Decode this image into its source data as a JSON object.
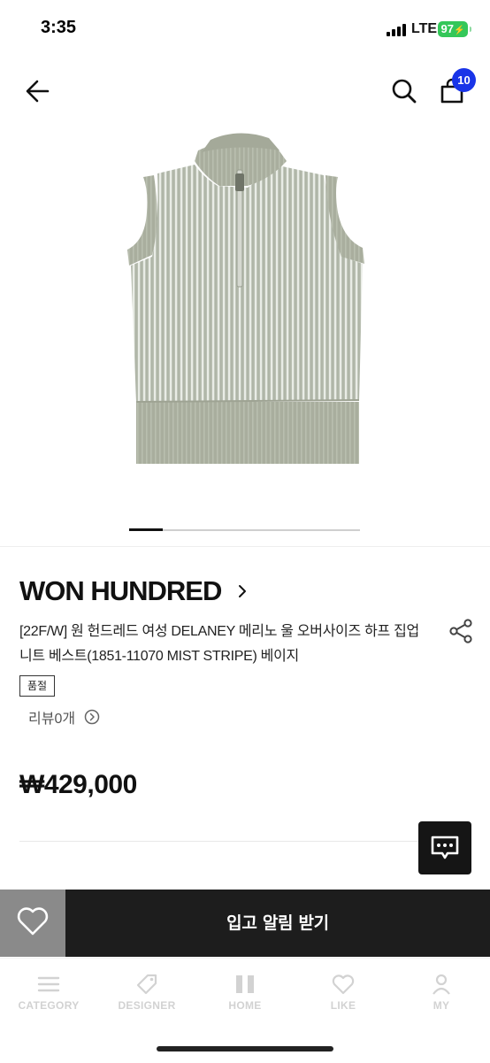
{
  "status_bar": {
    "time": "3:35",
    "network": "LTE",
    "battery": "97"
  },
  "header": {
    "back_icon": "arrow-left-icon",
    "search_icon": "search-icon",
    "cart_icon": "shopping-bag-icon",
    "cart_count": "10",
    "badge_color": "#1934e8"
  },
  "carousel": {
    "current_index": 1,
    "progress": 0.145
  },
  "product": {
    "brand": "WON HUNDRED",
    "title": "[22F/W] 원 헌드레드 여성 DELANEY 메리노 울 오버사이즈 하프 집업 니트 베스트(1851-11070 MIST STRIPE) 베이지",
    "badge": "품절",
    "reviews": "리뷰0개",
    "price": "₩429,000"
  },
  "actions": {
    "like_icon": "heart-icon",
    "cta_label": "입고 알림 받기",
    "chat_icon": "chat-icon"
  },
  "tab_bar": {
    "items": [
      {
        "label": "CATEGORY",
        "icon": "menu-icon"
      },
      {
        "label": "DESIGNER",
        "icon": "tag-icon"
      },
      {
        "label": "HOME",
        "icon": "home-icon"
      },
      {
        "label": "LIKE",
        "icon": "heart-icon"
      },
      {
        "label": "MY",
        "icon": "user-icon"
      }
    ]
  }
}
